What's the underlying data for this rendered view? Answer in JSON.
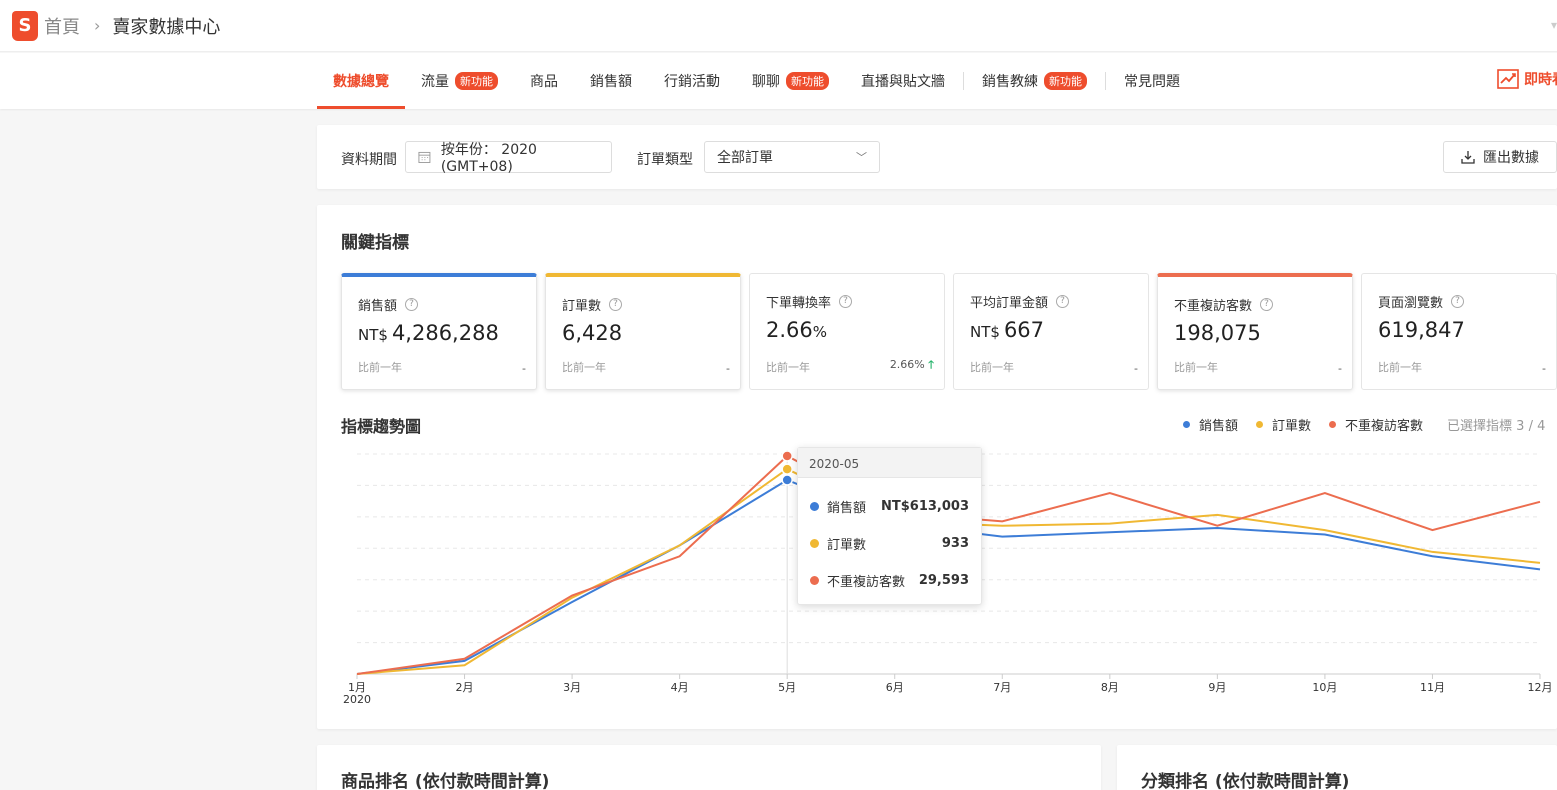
{
  "header": {
    "logo_letter": "S",
    "breadcrumb_home": "首頁",
    "breadcrumb_current": "賣家數據中心"
  },
  "nav": {
    "tabs": [
      {
        "label": "數據總覽",
        "active": true
      },
      {
        "label": "流量",
        "badge": "新功能"
      },
      {
        "label": "商品"
      },
      {
        "label": "銷售額"
      },
      {
        "label": "行銷活動"
      },
      {
        "label": "聊聊",
        "badge": "新功能"
      },
      {
        "label": "直播與貼文牆"
      },
      {
        "label": "銷售教練",
        "badge": "新功能"
      },
      {
        "label": "常見問題"
      }
    ],
    "realtime_label": "即時看"
  },
  "filters": {
    "period_label": "資料期間",
    "period_value": "按年份： 2020 (GMT+08)",
    "order_type_label": "訂單類型",
    "order_type_value": "全部訂單",
    "export_label": "匯出數據"
  },
  "key_metrics": {
    "title": "關鍵指標",
    "compare_label": "比前一年",
    "cards": [
      {
        "name": "銷售額",
        "currency": "NT$",
        "value": "4,286,288",
        "change": "-",
        "selected": "blue"
      },
      {
        "name": "訂單數",
        "currency": "",
        "value": "6,428",
        "change": "-",
        "selected": "yellow"
      },
      {
        "name": "下單轉換率",
        "currency": "",
        "value": "2.66",
        "suffix": "%",
        "change": "2.66%",
        "change_dir": "up"
      },
      {
        "name": "平均訂單金額",
        "currency": "NT$",
        "value": "667",
        "change": "-"
      },
      {
        "name": "不重複訪客數",
        "currency": "",
        "value": "198,075",
        "change": "-",
        "selected": "red"
      },
      {
        "name": "頁面瀏覽數",
        "currency": "",
        "value": "619,847",
        "change": "-"
      }
    ]
  },
  "trend": {
    "title": "指標趨勢圖",
    "selected_count": "已選擇指標 3 / 4",
    "legend": [
      {
        "name": "銷售額",
        "color": "#3d7dd7"
      },
      {
        "name": "訂單數",
        "color": "#f0b833"
      },
      {
        "name": "不重複訪客數",
        "color": "#ec6d4f"
      }
    ]
  },
  "chart_data": {
    "type": "line",
    "x": [
      "1月",
      "2月",
      "3月",
      "4月",
      "5月",
      "6月",
      "7月",
      "8月",
      "9月",
      "10月",
      "11月",
      "12月"
    ],
    "x_year_label": "2020",
    "normalized": true,
    "series": [
      {
        "name": "銷售額",
        "color": "#3d7dd7",
        "values": [
          0.0,
          0.06,
          0.33,
          0.59,
          0.89,
          0.69,
          0.63,
          0.65,
          0.67,
          0.64,
          0.54,
          0.48
        ]
      },
      {
        "name": "訂單數",
        "color": "#f0b833",
        "values": [
          0.0,
          0.04,
          0.35,
          0.59,
          0.94,
          0.7,
          0.68,
          0.69,
          0.73,
          0.66,
          0.56,
          0.51
        ]
      },
      {
        "name": "不重複訪客數",
        "color": "#ec6d4f",
        "values": [
          0.0,
          0.07,
          0.36,
          0.54,
          1.0,
          0.74,
          0.7,
          0.83,
          0.68,
          0.83,
          0.66,
          0.79
        ]
      }
    ],
    "hover_index": 4
  },
  "tooltip": {
    "date": "2020-05",
    "rows": [
      {
        "name": "銷售額",
        "value": "NT$613,003",
        "color": "#3d7dd7"
      },
      {
        "name": "訂單數",
        "value": "933",
        "color": "#f0b833"
      },
      {
        "name": "不重複訪客數",
        "value": "29,593",
        "color": "#ec6d4f"
      }
    ]
  },
  "bottom": {
    "product_ranking_title": "商品排名 (依付款時間計算)",
    "category_ranking_title": "分類排名 (依付款時間計算)"
  }
}
